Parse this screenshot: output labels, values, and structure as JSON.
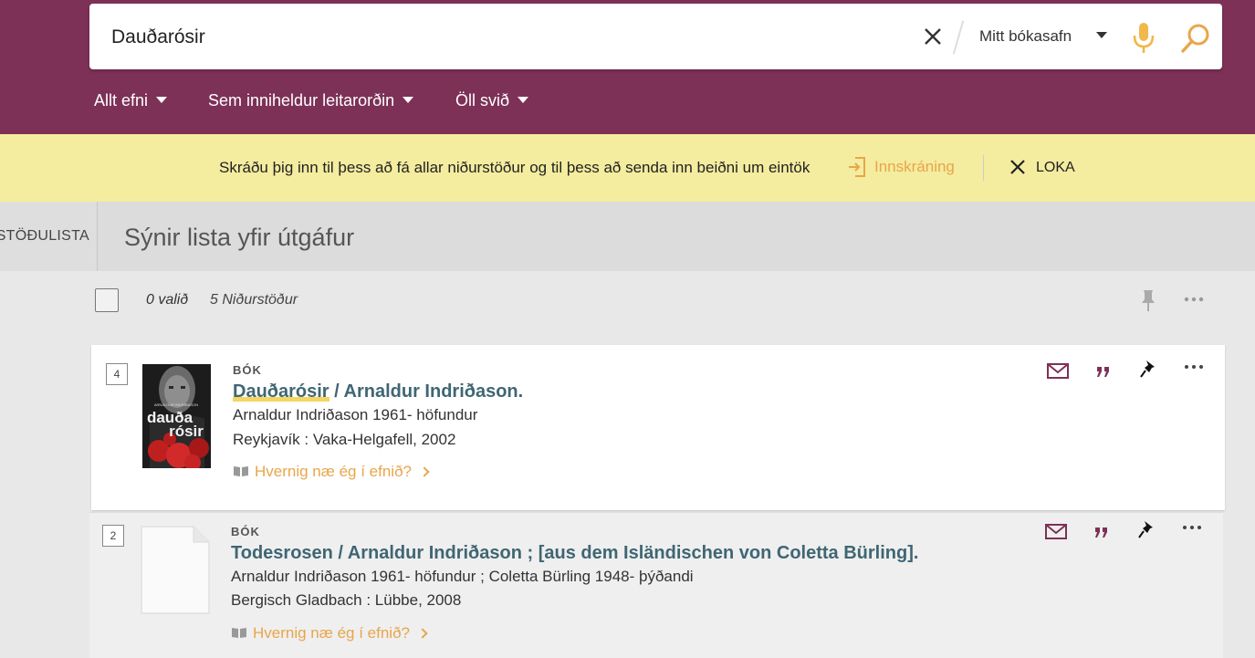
{
  "search": {
    "query": "Dauðarósir",
    "scope_label": "Mitt bókasafn"
  },
  "filters": [
    {
      "label": "Allt efni"
    },
    {
      "label": "Sem inniheldur leitarorðin"
    },
    {
      "label": "Öll svið"
    }
  ],
  "notice": {
    "text": "Skráðu þig inn til þess að fá allar niðurstöður og til þess að senda inn beiðni um eintök",
    "login_label": "Innskráning",
    "close_label": "LOKA"
  },
  "results_header": {
    "side_tab_label": "RSTÖÐULISTA",
    "title": "Sýnir lista yfir útgáfur"
  },
  "toolbar": {
    "selected_count": "0 valið",
    "result_count": "5 Niðurstöður"
  },
  "results": [
    {
      "number": "4",
      "type": "BÓK",
      "title_highlight": "Dauðarósir",
      "title_rest": " / Arnaldur Indriðason.",
      "author": "Arnaldur Indriðason 1961- höfundur",
      "publisher": "Reykjavík : Vaka-Helgafell, 2002",
      "howto": "Hvernig næ ég í efnið?",
      "cover": {
        "top_text": "ARNALDUR INDRIÐASON",
        "title_line1": "dauða",
        "title_line2": "rósir"
      }
    },
    {
      "number": "2",
      "type": "BÓK",
      "title": "Todesrosen / Arnaldur Indriðason ; [aus dem Isländischen von Coletta Bürling].",
      "author": "Arnaldur Indriðason 1961- höfundur ; Coletta Bürling 1948- þýðandi",
      "publisher": "Bergisch Gladbach : Lübbe, 2008",
      "howto": "Hvernig næ ég í efnið?"
    }
  ],
  "colors": {
    "header_bg": "#7d3157",
    "notice_bg": "#f4ec9f",
    "accent_orange": "#e8a64a",
    "title_teal": "#3f6673",
    "action_maroon": "#7d3157"
  }
}
